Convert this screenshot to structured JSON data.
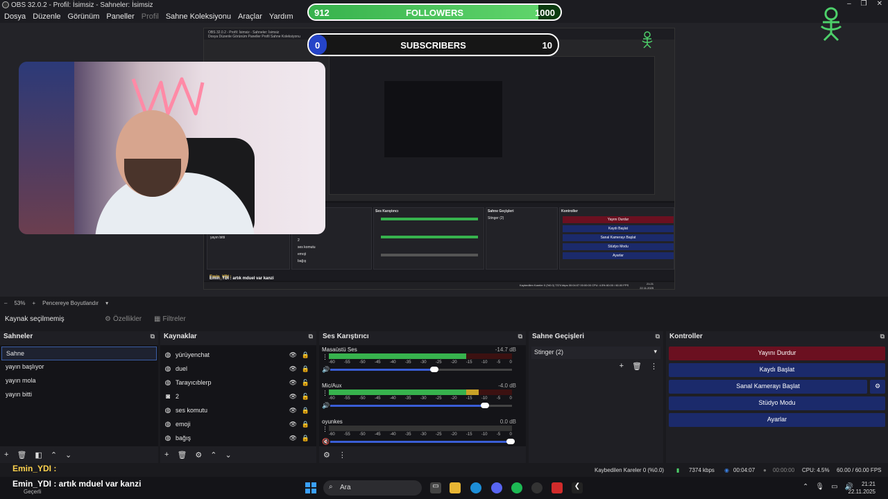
{
  "window": {
    "title": "OBS 32.0.2 - Profil: İsimsiz - Sahneler: İsimsiz",
    "controls": [
      "–",
      "❐",
      "✕"
    ]
  },
  "menu": {
    "items": [
      "Dosya",
      "Düzenle",
      "Görünüm",
      "Paneller",
      "Profil",
      "Sahne Koleksiyonu",
      "Araçlar",
      "Yardım"
    ]
  },
  "overlay": {
    "followers": {
      "current": "912",
      "goal": "1000",
      "label": "FOLLOWERS",
      "progress": 0.912
    },
    "subscribers": {
      "current": "0",
      "goal": "10",
      "label": "SUBSCRIBERS",
      "progress": 0.0
    }
  },
  "nested_preview": {
    "menu_text": "OBS 32.0.2 - Profil: İsimsiz - Sahneler: İsimsiz",
    "menu_items": "Dosya   Düzenle   Görünüm   Paneller   Profil   Sahne Koleksiyonu",
    "dock_titles": [
      "Ses Karıştırıcı",
      "Sahne Geçişleri",
      "Kontroller"
    ],
    "scene": "yayın bitti",
    "sources": [
      "2",
      "ses komutu",
      "emoji",
      "bağış"
    ],
    "transition": "Stinger (2)",
    "ctrl_buttons": [
      "Yayını Durdur",
      "Kaydı Başlat",
      "Sanal Kamerayı Başlat",
      "Stüdyo Modu",
      "Ayarlar"
    ],
    "chat_user": "Emin_YDI :",
    "chat_line": "Emin_YDI : artık mduel var kanzi",
    "status": "Kaybedilen Kareler 0 (%0.0)   7374 kbps   00:04:07   00:00:00   CPU: 4.5%   60.00 / 60.00 FPS",
    "clock_time": "21:21",
    "clock_date": "22.11.2025"
  },
  "zoom": {
    "minus": "–",
    "value": "53%",
    "plus": "+",
    "mode": "Pencereye Boyutlandır"
  },
  "source_toolbar": {
    "status": "Kaynak seçilmemiş",
    "properties": "Özellikler",
    "filters": "Filtreler"
  },
  "scenes": {
    "title": "Sahneler",
    "items": [
      "Sahne",
      "yayın başlıyor",
      "yayın mola",
      "yayın bitti"
    ],
    "active": 0
  },
  "sources": {
    "title": "Kaynaklar",
    "items": [
      {
        "name": "yürüyenchat",
        "icon": "globe-icon"
      },
      {
        "name": "duel",
        "icon": "globe-icon"
      },
      {
        "name": "Tarayıcıblerp",
        "icon": "globe-icon"
      },
      {
        "name": "2",
        "icon": "camera-icon"
      },
      {
        "name": "ses komutu",
        "icon": "globe-icon"
      },
      {
        "name": "emoji",
        "icon": "globe-icon"
      },
      {
        "name": "bağış",
        "icon": "globe-icon"
      }
    ]
  },
  "mixer": {
    "title": "Ses Karıştırıcı",
    "scale": [
      "-60",
      "-55",
      "-50",
      "-45",
      "-40",
      "-35",
      "-30",
      "-25",
      "-20",
      "-15",
      "-10",
      "-5",
      "0"
    ],
    "channels": [
      {
        "name": "Masaüstü Ses",
        "db": "-14.7 dB",
        "level": 0.75,
        "volume": 0.58,
        "muted": false
      },
      {
        "name": "Mic/Aux",
        "db": "-4.0 dB",
        "level": 0.82,
        "volume": 0.86,
        "muted": false
      },
      {
        "name": "oyunkes",
        "db": "0.0 dB",
        "level": 0.0,
        "volume": 1.0,
        "muted": true
      }
    ]
  },
  "transitions": {
    "title": "Sahne Geçişleri",
    "selected": "Stinger (2)"
  },
  "controls": {
    "title": "Kontroller",
    "buttons": [
      "Yayını Durdur",
      "Kaydı Başlat",
      "Sanal Kamerayı Başlat",
      "Stüdyo Modu",
      "Ayarlar"
    ]
  },
  "status": {
    "dropped": "Kaybedilen Kareler 0 (%0.0)",
    "bitrate": "7374 kbps",
    "stream_time": "00:04:07",
    "rec_time": "00:00:00",
    "cpu": "CPU: 4.5%",
    "fps": "60.00 / 60.00 FPS"
  },
  "chat": {
    "user": "Emin_YDI :",
    "message": "Emin_YDI : artık mduel var kanzi",
    "sub": "Geçerli"
  },
  "taskbar": {
    "search": "Ara",
    "time": "21:21",
    "date": "22.11.2025"
  },
  "colors": {
    "accent_blue": "#1b2a6b",
    "stream_red": "#6b1020",
    "meter_green": "#37b24d",
    "mascot_green": "#4dd06a"
  }
}
